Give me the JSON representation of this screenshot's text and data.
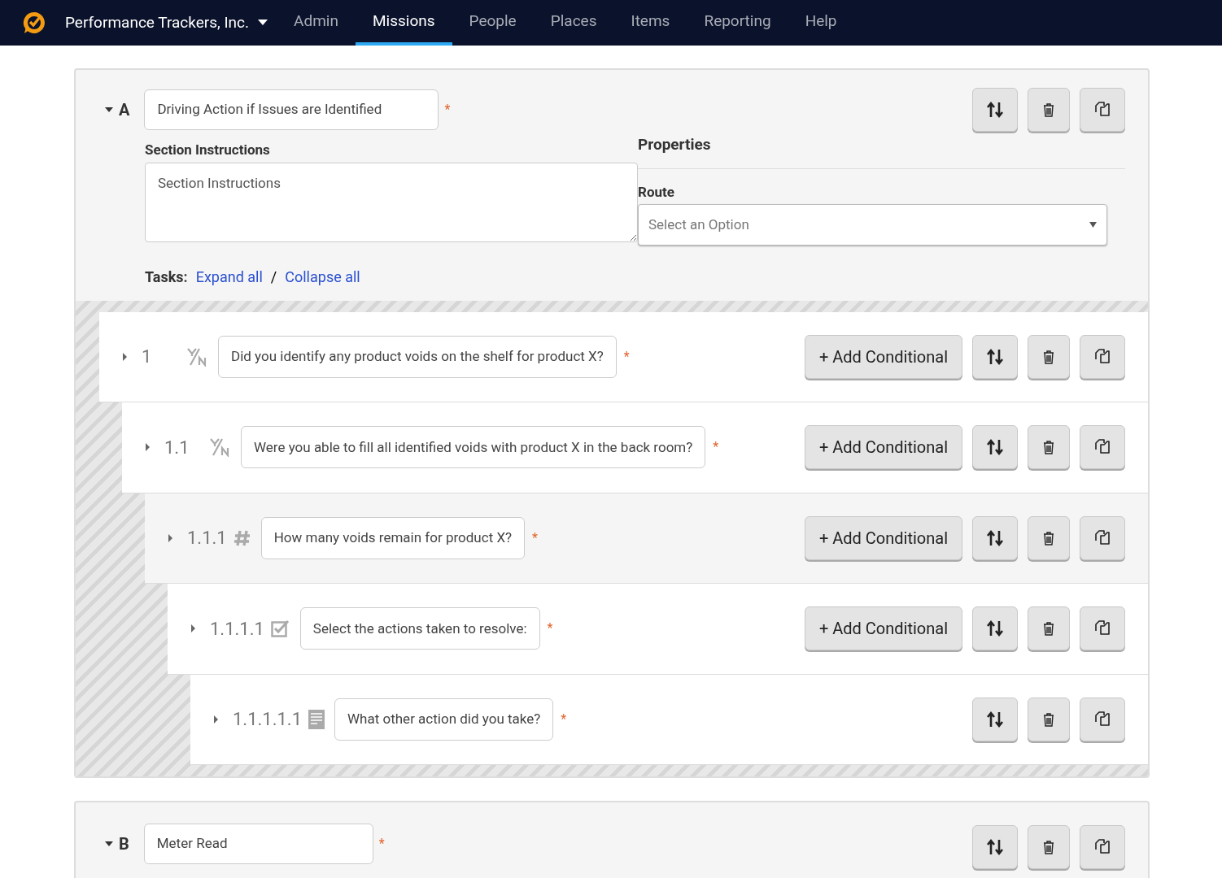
{
  "nav": {
    "company": "Performance Trackers, Inc.",
    "items": [
      {
        "label": "Admin",
        "selected": false
      },
      {
        "label": "Missions",
        "selected": true
      },
      {
        "label": "People",
        "selected": false
      },
      {
        "label": "Places",
        "selected": false
      },
      {
        "label": "Items",
        "selected": false
      },
      {
        "label": "Reporting",
        "selected": false
      },
      {
        "label": "Help",
        "selected": false
      }
    ]
  },
  "sections": [
    {
      "letter": "A",
      "expanded": true,
      "title": "Driving Action if Issues are Identified",
      "required": "*",
      "instructions_label": "Section Instructions",
      "instructions_placeholder": "Section Instructions",
      "properties_heading": "Properties",
      "route_label": "Route",
      "route_placeholder": "Select an Option",
      "tasks_label": "Tasks:",
      "expand": "Expand all",
      "separator": "/",
      "collapse": "Collapse all",
      "tasks": [
        {
          "number": "1",
          "kind": "yesno",
          "question": "Did you identify any product voids on the shelf for product X?",
          "required": "*",
          "conditional": "+ Add Conditional",
          "highlighted": false,
          "children": [
            {
              "number": "1.1",
              "kind": "yesno",
              "question": "Were you able to fill all identified voids with product X in the back room?",
              "required": "*",
              "conditional": "+ Add Conditional",
              "highlighted": false,
              "children": [
                {
                  "number": "1.1.1",
                  "kind": "number",
                  "question": "How many voids remain for product X?",
                  "required": "*",
                  "conditional": "+ Add Conditional",
                  "highlighted": true,
                  "children": [
                    {
                      "number": "1.1.1.1",
                      "kind": "checkbox",
                      "question": "Select the actions taken to resolve:",
                      "required": "*",
                      "conditional": "+ Add Conditional",
                      "highlighted": false,
                      "children": [
                        {
                          "number": "1.1.1.1.1",
                          "kind": "text",
                          "question": "What other action did you take?",
                          "required": "*",
                          "highlighted": false
                        }
                      ]
                    }
                  ]
                }
              ]
            }
          ]
        }
      ]
    },
    {
      "letter": "B",
      "expanded": true,
      "title": "Meter Read",
      "required": "*"
    }
  ]
}
